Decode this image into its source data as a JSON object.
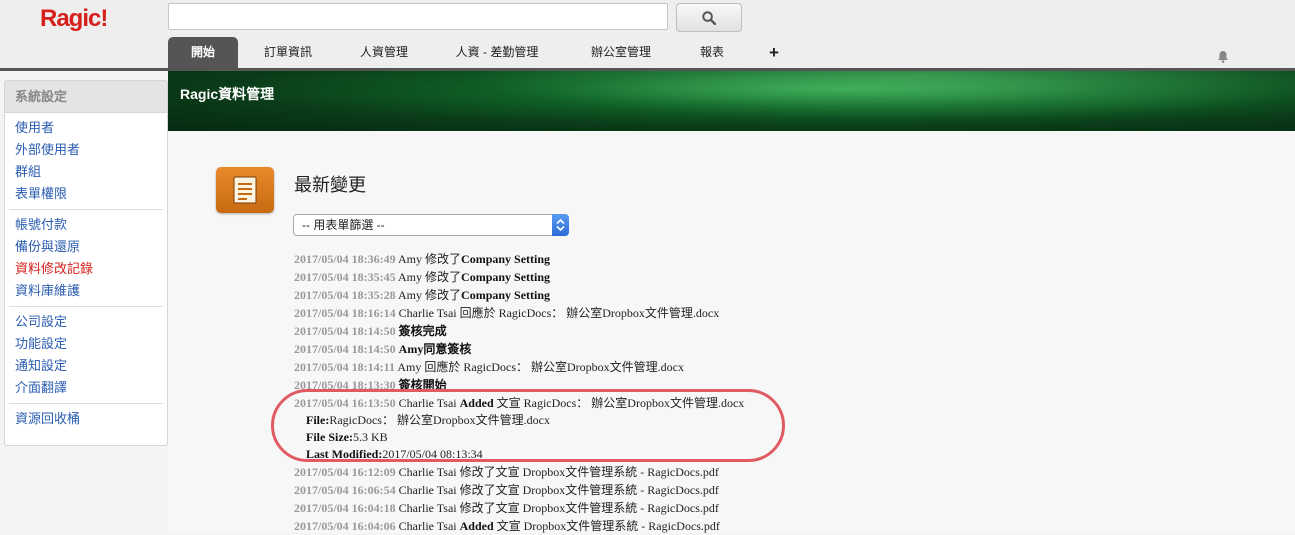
{
  "app": {
    "logo": "Ragic!"
  },
  "search": {
    "placeholder": ""
  },
  "tabs": [
    {
      "label": "開始",
      "active": true
    },
    {
      "label": "訂單資訊"
    },
    {
      "label": "人資管理"
    },
    {
      "label": "人資 - 差勤管理"
    },
    {
      "label": "辦公室管理"
    },
    {
      "label": "報表"
    },
    {
      "label": "+"
    }
  ],
  "sidebar": {
    "title": "系統設定",
    "groups": [
      [
        "使用者",
        "外部使用者",
        "群組",
        "表單權限"
      ],
      [
        "帳號付款",
        "備份與還原",
        "資料修改記錄",
        "資料庫維護"
      ],
      [
        "公司設定",
        "功能設定",
        "通知設定",
        "介面翻譯"
      ],
      [
        "資源回收桶"
      ]
    ],
    "current": "資料修改記錄"
  },
  "banner": {
    "title": "Ragic資料管理"
  },
  "main": {
    "title": "最新變更",
    "filter": "-- 用表單篩選 --"
  },
  "log": [
    {
      "ts": "2017/05/04 18:36:49",
      "parts": [
        "Amy 修改了",
        "Company Setting"
      ]
    },
    {
      "ts": "2017/05/04 18:35:45",
      "parts": [
        "Amy 修改了",
        "Company Setting"
      ]
    },
    {
      "ts": "2017/05/04 18:35:28",
      "parts": [
        "Amy 修改了",
        "Company Setting"
      ]
    },
    {
      "ts": "2017/05/04 18:16:14",
      "parts": [
        "Charlie Tsai 回應於 RagicDocs： 辦公室Dropbox文件管理.docx"
      ]
    },
    {
      "ts": "2017/05/04 18:14:50",
      "parts": [
        "簽核完成"
      ]
    },
    {
      "ts": "2017/05/04 18:14:50",
      "parts": [
        "Amy同意簽核"
      ]
    },
    {
      "ts": "2017/05/04 18:14:11",
      "parts": [
        "Amy 回應於 RagicDocs： 辦公室Dropbox文件管理.docx"
      ]
    },
    {
      "ts": "2017/05/04 18:13:30",
      "parts": [
        "簽核開始"
      ]
    },
    {
      "ts": "2017/05/04 16:13:50",
      "actor": "Charlie Tsai",
      "action": "Added",
      "rest": "文宣 RagicDocs： 辦公室Dropbox文件管理.docx"
    },
    {
      "ts": "2017/05/04 16:12:09",
      "parts": [
        "Charlie Tsai 修改了文宣 Dropbox文件管理系統 - RagicDocs.pdf"
      ]
    },
    {
      "ts": "2017/05/04 16:06:54",
      "parts": [
        "Charlie Tsai 修改了文宣 Dropbox文件管理系統 - RagicDocs.pdf"
      ]
    },
    {
      "ts": "2017/05/04 16:04:18",
      "parts": [
        "Charlie Tsai 修改了文宣 Dropbox文件管理系統 - RagicDocs.pdf"
      ]
    },
    {
      "ts": "2017/05/04 16:04:06",
      "actor": "Charlie Tsai",
      "action": "Added",
      "rest": "文宣 Dropbox文件管理系統 - RagicDocs.pdf"
    }
  ],
  "detail": {
    "file_label": "File:",
    "file_value": "RagicDocs： 辦公室Dropbox文件管理.docx",
    "size_label": "File Size:",
    "size_value": "5.3 KB",
    "modified_label": "Last Modified:",
    "modified_value": "2017/05/04 08:13:34"
  },
  "colors": {
    "brand": "#d6201b",
    "link": "#2a5db0",
    "highlight": "#e05a62"
  }
}
